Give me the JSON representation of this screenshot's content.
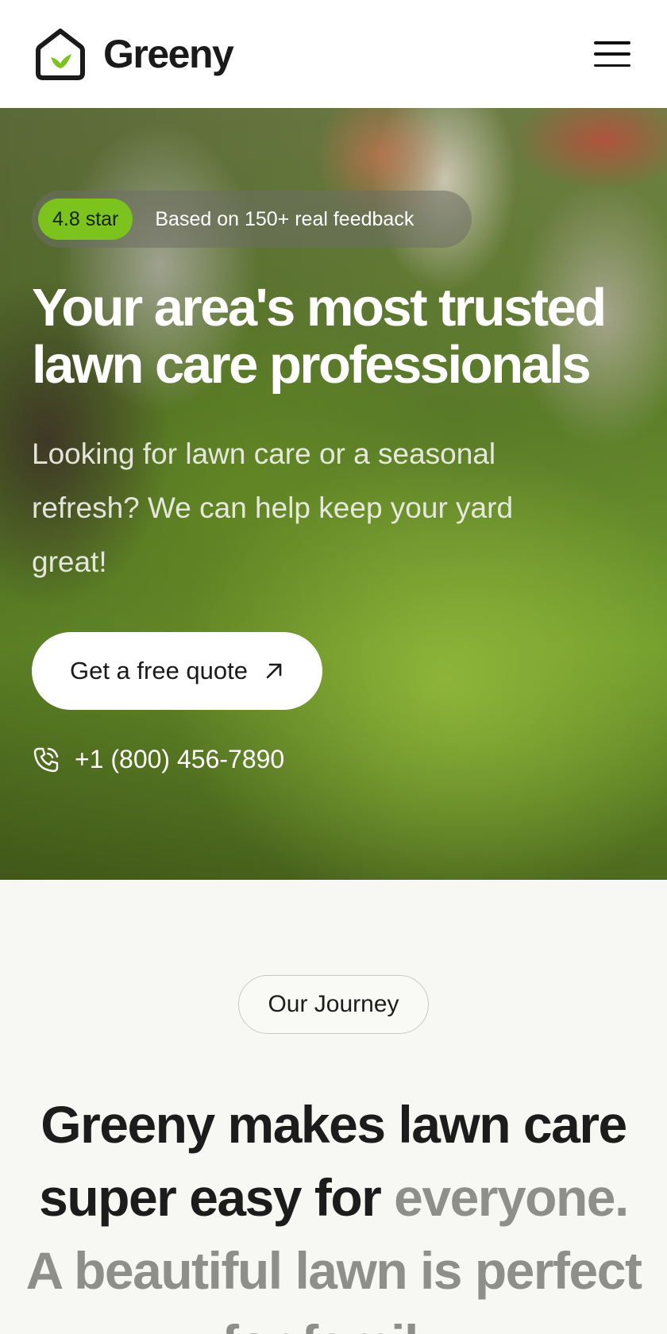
{
  "header": {
    "brand_name": "Greeny",
    "logo_icon": "house-leaf-icon",
    "menu_icon": "hamburger-menu-icon"
  },
  "hero": {
    "rating_badge": "4.8 star",
    "rating_text": "Based on 150+ real feedback",
    "title_line1": "Your area's most trusted",
    "title_line2": "lawn care professionals",
    "subtitle": "Looking for lawn care or a seasonal refresh? We can help keep your yard great!",
    "cta_label": "Get a free quote",
    "cta_icon": "arrow-up-right-icon",
    "phone_icon": "phone-icon",
    "phone": "+1 (800) 456-7890"
  },
  "journey": {
    "pill_label": "Our Journey",
    "title_dark": "Greeny makes lawn care super easy for ",
    "title_muted": "everyone. A beautiful lawn is perfect for family"
  },
  "colors": {
    "accent_green": "#7cc31e",
    "text_dark": "#1c1c1c",
    "text_muted": "#8e8e8a",
    "section_bg": "#f7f7f3"
  }
}
